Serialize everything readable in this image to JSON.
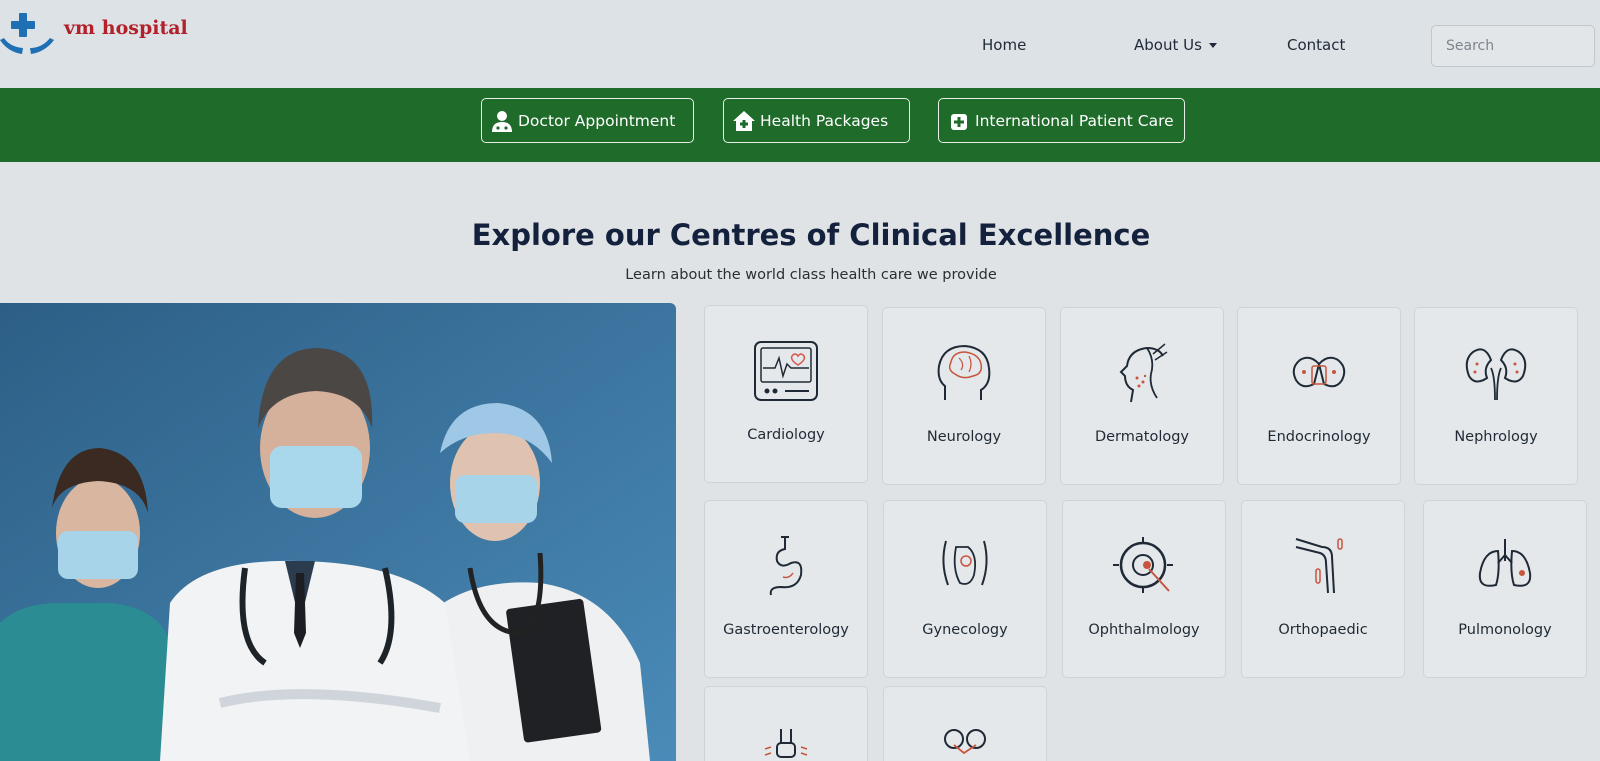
{
  "brand": {
    "name": "vm hospital",
    "logo_icon": "hospital-cross-hands-icon",
    "accent": "#1f6b2a"
  },
  "nav": {
    "home": "Home",
    "about": "About Us",
    "contact": "Contact"
  },
  "search": {
    "placeholder": "Search"
  },
  "quick_links": [
    {
      "label": "Doctor Appointment",
      "icon": "doctor-icon"
    },
    {
      "label": "Health Packages",
      "icon": "house-plus-icon"
    },
    {
      "label": "International Patient Care",
      "icon": "plus-square-icon"
    }
  ],
  "section": {
    "title": "Explore our Centres of Clinical Excellence",
    "subtitle": "Learn about the world class health care we provide"
  },
  "specialties": [
    {
      "label": "Cardiology",
      "icon": "heart-monitor-icon"
    },
    {
      "label": "Neurology",
      "icon": "brain-head-icon"
    },
    {
      "label": "Dermatology",
      "icon": "face-skin-icon"
    },
    {
      "label": "Endocrinology",
      "icon": "thyroid-icon"
    },
    {
      "label": "Nephrology",
      "icon": "kidneys-icon"
    },
    {
      "label": "Gastroenterology",
      "icon": "stomach-icon"
    },
    {
      "label": "Gynecology",
      "icon": "uterus-baby-icon"
    },
    {
      "label": "Ophthalmology",
      "icon": "eye-icon"
    },
    {
      "label": "Orthopaedic",
      "icon": "bone-joint-icon"
    },
    {
      "label": "Pulmonology",
      "icon": "lungs-icon"
    },
    {
      "label": "",
      "icon": "spine-icon"
    },
    {
      "label": "",
      "icon": "urology-icon"
    }
  ]
}
